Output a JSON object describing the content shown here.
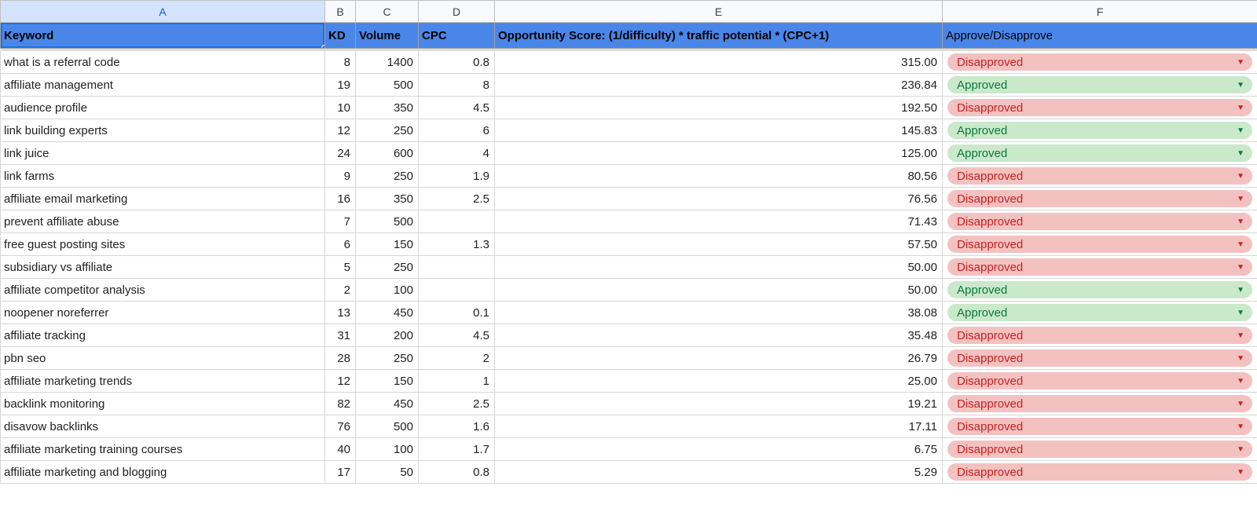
{
  "columns": {
    "A": "A",
    "B": "B",
    "C": "C",
    "D": "D",
    "E": "E",
    "F": "F"
  },
  "headers": {
    "keyword": "Keyword",
    "kd": "KD",
    "volume": "Volume",
    "cpc": "CPC",
    "opp": "Opportunity Score: (1/difficulty) * traffic potential * (CPC+1)",
    "approve": "Approve/Disapprove"
  },
  "status_labels": {
    "approved": "Approved",
    "disapproved": "Disapproved"
  },
  "caret_glyph": "▼",
  "rows": [
    {
      "keyword": "what is a referral code",
      "kd": "8",
      "volume": "1400",
      "cpc": "0.8",
      "opp": "315.00",
      "status": "disapproved"
    },
    {
      "keyword": "affiliate management",
      "kd": "19",
      "volume": "500",
      "cpc": "8",
      "opp": "236.84",
      "status": "approved"
    },
    {
      "keyword": "audience profile",
      "kd": "10",
      "volume": "350",
      "cpc": "4.5",
      "opp": "192.50",
      "status": "disapproved"
    },
    {
      "keyword": "link building experts",
      "kd": "12",
      "volume": "250",
      "cpc": "6",
      "opp": "145.83",
      "status": "approved"
    },
    {
      "keyword": "link juice",
      "kd": "24",
      "volume": "600",
      "cpc": "4",
      "opp": "125.00",
      "status": "approved"
    },
    {
      "keyword": "link farms",
      "kd": "9",
      "volume": "250",
      "cpc": "1.9",
      "opp": "80.56",
      "status": "disapproved"
    },
    {
      "keyword": "affiliate email marketing",
      "kd": "16",
      "volume": "350",
      "cpc": "2.5",
      "opp": "76.56",
      "status": "disapproved"
    },
    {
      "keyword": "prevent affiliate abuse",
      "kd": "7",
      "volume": "500",
      "cpc": "",
      "opp": "71.43",
      "status": "disapproved"
    },
    {
      "keyword": "free guest posting sites",
      "kd": "6",
      "volume": "150",
      "cpc": "1.3",
      "opp": "57.50",
      "status": "disapproved"
    },
    {
      "keyword": "subsidiary vs affiliate",
      "kd": "5",
      "volume": "250",
      "cpc": "",
      "opp": "50.00",
      "status": "disapproved"
    },
    {
      "keyword": "affiliate competitor analysis",
      "kd": "2",
      "volume": "100",
      "cpc": "",
      "opp": "50.00",
      "status": "approved"
    },
    {
      "keyword": "noopener noreferrer",
      "kd": "13",
      "volume": "450",
      "cpc": "0.1",
      "opp": "38.08",
      "status": "approved"
    },
    {
      "keyword": "affiliate tracking",
      "kd": "31",
      "volume": "200",
      "cpc": "4.5",
      "opp": "35.48",
      "status": "disapproved"
    },
    {
      "keyword": "pbn seo",
      "kd": "28",
      "volume": "250",
      "cpc": "2",
      "opp": "26.79",
      "status": "disapproved"
    },
    {
      "keyword": "affiliate marketing trends",
      "kd": "12",
      "volume": "150",
      "cpc": "1",
      "opp": "25.00",
      "status": "disapproved"
    },
    {
      "keyword": "backlink monitoring",
      "kd": "82",
      "volume": "450",
      "cpc": "2.5",
      "opp": "19.21",
      "status": "disapproved"
    },
    {
      "keyword": "disavow backlinks",
      "kd": "76",
      "volume": "500",
      "cpc": "1.6",
      "opp": "17.11",
      "status": "disapproved"
    },
    {
      "keyword": "affiliate marketing training courses",
      "kd": "40",
      "volume": "100",
      "cpc": "1.7",
      "opp": "6.75",
      "status": "disapproved"
    },
    {
      "keyword": "affiliate marketing and blogging",
      "kd": "17",
      "volume": "50",
      "cpc": "0.8",
      "opp": "5.29",
      "status": "disapproved"
    }
  ]
}
